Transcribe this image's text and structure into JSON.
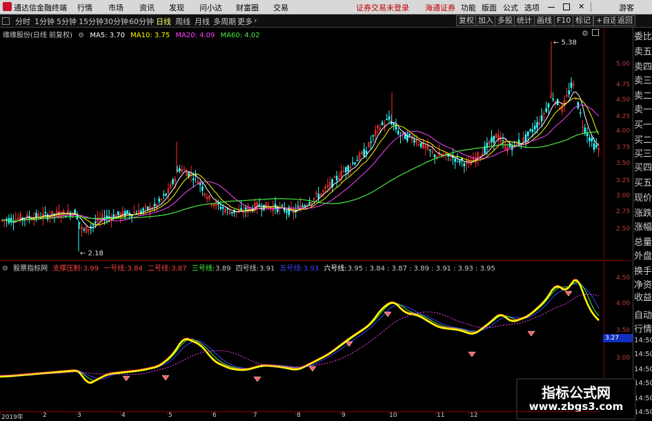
{
  "menubar": {
    "app_title": "通达信金融终端",
    "menus": [
      "行情",
      "市场",
      "资讯",
      "发现",
      "问小达",
      "财富圈",
      "交易"
    ],
    "account_status": "证券交易未登录",
    "broker": "海通证券",
    "right_items": [
      "功能",
      "版面",
      "公式",
      "选项"
    ],
    "guest": "游客"
  },
  "toolbar": {
    "periods": [
      "分时",
      "1分钟",
      "5分钟",
      "15分钟",
      "30分钟",
      "60分钟",
      "日线",
      "周线",
      "月线",
      "多周期",
      "更多"
    ],
    "active_period": "日线",
    "right_buttons": [
      "复权",
      "加入",
      "多股",
      "统计",
      "画线",
      "F10",
      "标记",
      "+自选",
      "返回"
    ]
  },
  "main_chart": {
    "stock_title": "维维股份(日线 前复权)",
    "ma_labels": [
      {
        "text": "MA5: 3.70",
        "color": "#ffffff"
      },
      {
        "text": "MA10: 3.75",
        "color": "#ffff00"
      },
      {
        "text": "MA20: 4.09",
        "color": "#ff44ff"
      },
      {
        "text": "MA60: 4.02",
        "color": "#44ee44"
      }
    ],
    "high_label": "5.38",
    "low_label": "2.18",
    "y_ticks": [
      "5.00",
      "4.75",
      "4.50",
      "4.25",
      "4.00",
      "3.75",
      "3.50",
      "3.25",
      "3.00",
      "2.75",
      "2.50"
    ]
  },
  "indicator": {
    "name": "股票指标网",
    "lines": [
      {
        "label": "支撑压制:",
        "value": "3.99",
        "label_color": "#ff4040",
        "value_color": "#ff4040"
      },
      {
        "label": "一号线:",
        "value": "3.84",
        "label_color": "#ff4040",
        "value_color": "#ff4040"
      },
      {
        "label": "二号线:",
        "value": "3.87",
        "label_color": "#ff4040",
        "value_color": "#ff4040"
      },
      {
        "label": "三号线:",
        "value": "3.89",
        "label_color": "#40ff40",
        "value_color": "#c8c8c8"
      },
      {
        "label": "四号线:",
        "value": "3.91",
        "label_color": "#c8c8c8",
        "value_color": "#c8c8c8"
      },
      {
        "label": "五号线:",
        "value": "3.93",
        "label_color": "#4040ff",
        "value_color": "#4040ff"
      },
      {
        "label": "六号线:",
        "value": "3.95 : 3.84 : 3.87 : 3.89 : 3.91 : 3.93 : 3.95",
        "label_color": "#ffffff",
        "value_color": "#c8c8c8"
      }
    ],
    "y_ticks": [
      "4.50",
      "4.00",
      "3.50",
      "3.00"
    ],
    "price_tag": "3.27"
  },
  "right_panel": {
    "items": [
      "委比",
      "卖五",
      "卖四",
      "卖三",
      "卖二",
      "卖一",
      "买一",
      "买二",
      "买三",
      "买四",
      "买五",
      "现价",
      "涨跌",
      "涨幅",
      "总量",
      "外盘",
      "换手",
      "净资",
      "收益",
      "自动",
      "行情",
      "14:50",
      "14:50",
      "14:50",
      "14:50",
      "14:50",
      "14:50",
      "14:50",
      "14:50"
    ]
  },
  "datebar": {
    "labels": [
      "2019年",
      "2",
      "3",
      "4",
      "5",
      "6",
      "7",
      "8",
      "9",
      "10",
      "11",
      "12"
    ]
  },
  "watermark": {
    "line1": "指标公式网",
    "line2": "www.zbgs3.com"
  },
  "colors": {
    "bg": "#000000",
    "up": "#ff3030",
    "down": "#30ffff",
    "ma5": "#ffffff",
    "ma10": "#ffff00",
    "ma20": "#ff44ff",
    "ma60": "#44ee44"
  }
}
